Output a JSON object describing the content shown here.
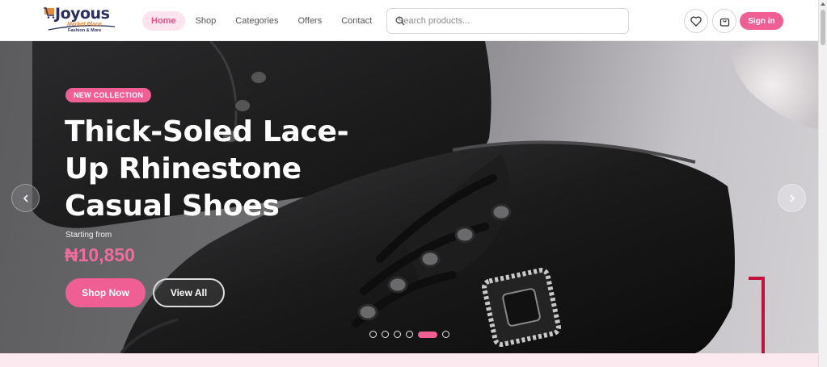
{
  "brand": {
    "name": "Joyous",
    "tagline": "Market Place",
    "subtitle": "Fashion & More"
  },
  "nav": {
    "items": [
      {
        "label": "Home",
        "active": true
      },
      {
        "label": "Shop"
      },
      {
        "label": "Categories"
      },
      {
        "label": "Offers"
      },
      {
        "label": "Contact"
      }
    ]
  },
  "search": {
    "placeholder": "Search products..."
  },
  "header_actions": {
    "wishlist_icon": "heart-icon",
    "cart_icon": "shopping-bag-icon",
    "signin_label": "Sign in"
  },
  "hero": {
    "badge": "NEW COLLECTION",
    "title": "Thick-Soled Lace-Up Rhinestone Casual Shoes",
    "starting_label": "Starting from",
    "price": "₦10,850",
    "primary_cta": "Shop Now",
    "secondary_cta": "View All",
    "prev_icon": "chevron-left-icon",
    "next_icon": "chevron-right-icon",
    "slides_total": 6,
    "slide_active": 5
  },
  "colors": {
    "accent": "#ef5f94",
    "accent_light": "#fde4ee",
    "brand_navy": "#2b2f5c",
    "brand_orange": "#e8883a"
  }
}
